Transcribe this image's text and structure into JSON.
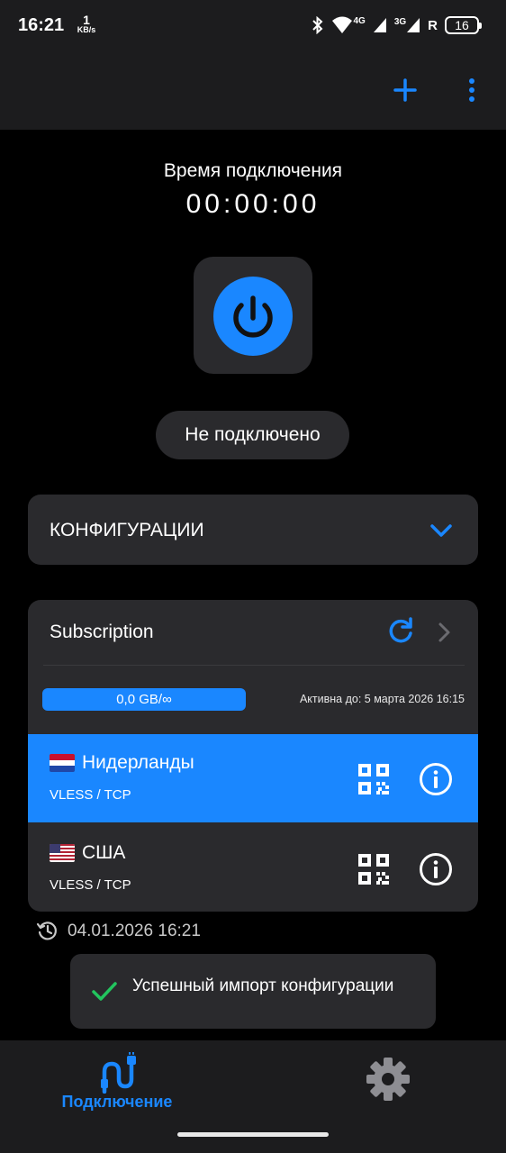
{
  "status_bar": {
    "time": "16:21",
    "speed_value": "1",
    "speed_unit": "KB/s",
    "net_4g": "4G",
    "net_3g": "3G",
    "roaming": "R",
    "battery": "16"
  },
  "app_bar": {
    "add_icon": "plus-icon",
    "menu_icon": "more-vert-icon"
  },
  "connection": {
    "timer_label": "Время подключения",
    "timer": "00:00:00",
    "status": "Не подключено"
  },
  "configs": {
    "title": "КОНФИГУРАЦИИ"
  },
  "subscription": {
    "title": "Subscription",
    "traffic": "0,0 GB/∞",
    "expiry": "Активна до: 5 марта 2026 16:15",
    "servers": [
      {
        "name": "Нидерланды",
        "protocol": "VLESS / TCP",
        "flag": "nl",
        "selected": true
      },
      {
        "name": "США",
        "protocol": "VLESS / TCP",
        "flag": "us",
        "selected": false
      }
    ],
    "last_update": "04.01.2026 16:21"
  },
  "toast": {
    "text": "Успешный импорт конфигурации"
  },
  "nav": {
    "connection_label": "Подключение",
    "settings_icon": "gear-icon"
  },
  "colors": {
    "accent": "#1a87ff",
    "background": "#000000",
    "surface": "#2a2a2d",
    "success": "#22c55e"
  }
}
